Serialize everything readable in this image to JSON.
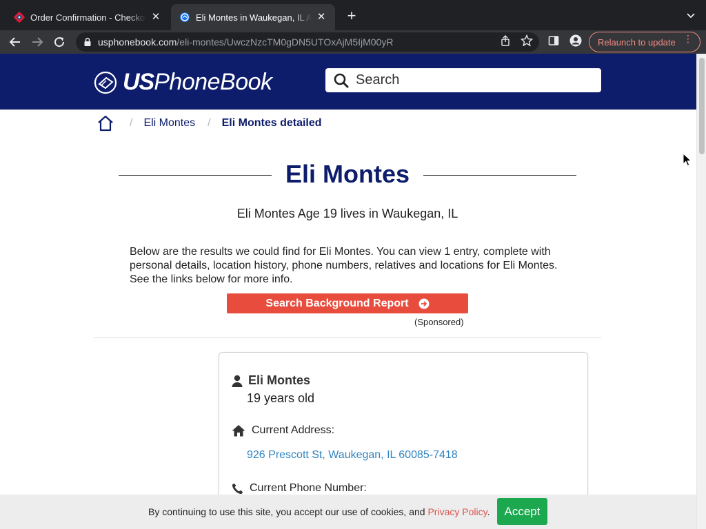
{
  "browser": {
    "tabs": [
      {
        "title": "Order Confirmation - Checkout",
        "active": false,
        "icon": "dominos-favicon"
      },
      {
        "title": "Eli Montes in Waukegan, IL Age",
        "active": true,
        "icon": "usphonebook-favicon"
      }
    ],
    "address_host": "usphonebook.com",
    "address_path": "/eli-montes/UwczNzcTM0gDN5UTOxAjM5IjM00yR",
    "relaunch_label": "Relaunch to update"
  },
  "site": {
    "logo_bold": "US",
    "logo_rest": "PhoneBook",
    "search_placeholder": "Search"
  },
  "breadcrumb": {
    "items": [
      {
        "label": "Eli Montes"
      },
      {
        "label": "Eli Montes detailed"
      }
    ]
  },
  "main": {
    "title": "Eli Montes",
    "subtitle": "Eli Montes Age 19 lives in Waukegan, IL",
    "intro": "Below are the results we could find for Eli Montes. You can view 1 entry, complete with personal details, location history, phone numbers, relatives and locations for Eli Montes. See the links below for more info.",
    "bg_button_label": "Search Background Report",
    "sponsored": "(Sponsored)"
  },
  "card": {
    "name": "Eli Montes",
    "age": "19 years old",
    "address_label": "Current Address:",
    "address": "926 Prescott St, Waukegan, IL 60085-7418",
    "phone_label": "Current Phone Number:"
  },
  "cookie": {
    "message": "By continuing to use this site, you accept our use of cookies, and ",
    "policy_link": "Privacy Policy",
    "period": ".",
    "accept_label": "Accept"
  },
  "colors": {
    "brand_navy": "#0d1c6b",
    "button_red": "#e84c3d",
    "accept_green": "#1ca84f",
    "link_blue": "#2f85c2"
  }
}
